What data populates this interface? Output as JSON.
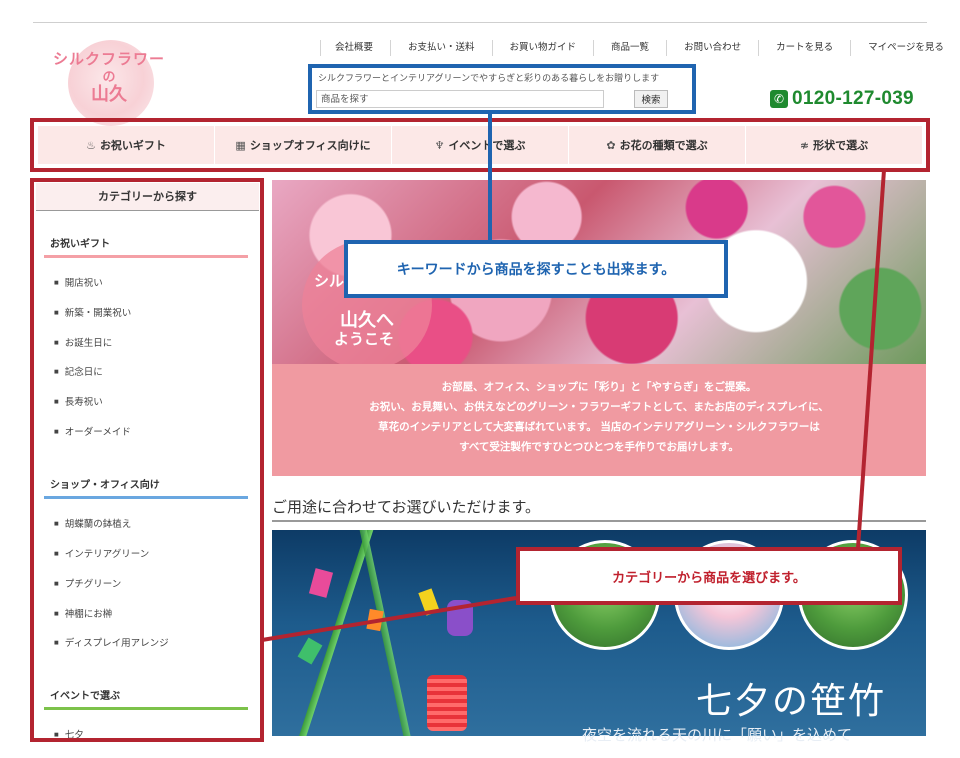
{
  "logo": {
    "line1": "シルクフラワー",
    "line2": "の",
    "line3": "山久"
  },
  "top_nav": [
    "会社概要",
    "お支払い・送料",
    "お買い物ガイド",
    "商品一覧",
    "お問い合わせ",
    "カートを見る",
    "マイページを見る"
  ],
  "search": {
    "tagline": "シルクフラワーとインテリアグリーンでやすらぎと彩りのある暮らしをお贈りします",
    "placeholder": "商品を探す",
    "button": "検索"
  },
  "phone": "0120-127-039",
  "category_nav": [
    {
      "label": "お祝いギフト",
      "icon": "gift-icon"
    },
    {
      "label": "ショップオフィス向けに",
      "icon": "building-icon"
    },
    {
      "label": "イベントで選ぶ",
      "icon": "event-icon"
    },
    {
      "label": "お花の種類で選ぶ",
      "icon": "flower-icon"
    },
    {
      "label": "形状で選ぶ",
      "icon": "shape-icon"
    }
  ],
  "sidebar": {
    "title": "カテゴリーから探す",
    "groups": [
      {
        "title": "お祝いギフト",
        "color": "#f4a0a6",
        "items": [
          "開店祝い",
          "新築・開業祝い",
          "お誕生日に",
          "記念日に",
          "長寿祝い",
          "オーダーメイド"
        ]
      },
      {
        "title": "ショップ・オフィス向け",
        "color": "#6aa7e0",
        "items": [
          "胡蝶蘭の鉢植え",
          "インテリアグリーン",
          "プチグリーン",
          "神棚にお榊",
          "ディスプレイ用アレンジ"
        ]
      },
      {
        "title": "イベントで選ぶ",
        "color": "#7cc24a",
        "items": [
          "七夕"
        ]
      }
    ]
  },
  "banner": {
    "t1": "シル",
    "t2": "山久へ",
    "t3": "ようこそ"
  },
  "intro_lines": [
    "お部屋、オフィス、ショップに「彩り」と「やすらぎ」をご提案。",
    "お祝い、お見舞い、お供えなどのグリーン・フラワーギフトとして、またお店のディスプレイに、",
    "草花のインテリアとして大変喜ばれています。 当店のインテリアグリーン・シルクフラワーは",
    "すべて受注製作ですひとつひとつを手作りでお届けします。"
  ],
  "section_title": "ご用途に合わせてお選びいただけます。",
  "tanabata": {
    "title": "七夕の笹竹",
    "subtitle": "夜空を流れる天の川に「願い」を込めて"
  },
  "callouts": {
    "search": "キーワードから商品を探すことも出来ます。",
    "category": "カテゴリーから商品を選びます。"
  },
  "colors": {
    "callout_blue": "#1f64b0",
    "callout_red": "#b32430",
    "phone_green": "#1f8a2f",
    "intro_bg": "#f09aa1"
  }
}
